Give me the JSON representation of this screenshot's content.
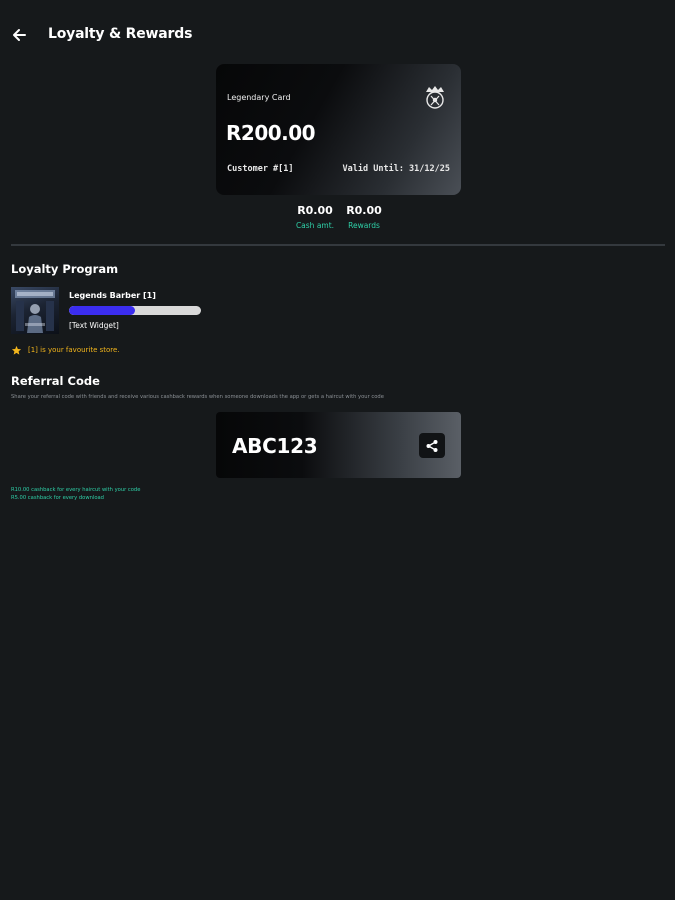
{
  "appbar": {
    "title": "Loyalty & Rewards",
    "back_icon": "arrow-left-icon"
  },
  "loyalty_card": {
    "name": "Legendary Card",
    "amount": "R200.00",
    "customer": "Customer #[1]",
    "valid_until": "Valid Until: 31/12/25",
    "logo_icon": "barber-logo-icon"
  },
  "balances": {
    "cash": {
      "value": "R0.00",
      "label": "Cash amt."
    },
    "rewards": {
      "value": "R0.00",
      "label": "Rewards"
    }
  },
  "loyalty_program": {
    "title": "Loyalty Program",
    "store_name": "Legends Barber [1]",
    "progress_fraction": 0.5,
    "progress_color": "#3b2df0",
    "text_widget": "[Text Widget]",
    "favourite_text": "[1] is your favourite store.",
    "favourite_icon": "star-icon"
  },
  "referral": {
    "title": "Referral Code",
    "description": "Share your referral code with friends and receive various cashback rewards when someone downloads the app or gets a haircut with your code",
    "code": "ABC123",
    "share_icon": "share-icon",
    "cashback_haircut": "R10.00 cashback for every haircut with your code",
    "cashback_download": "R5.00 cashback for every download"
  },
  "colors": {
    "background": "#16191b",
    "accent_teal": "#2fd0a8",
    "favourite_amber": "#f2b51c"
  }
}
